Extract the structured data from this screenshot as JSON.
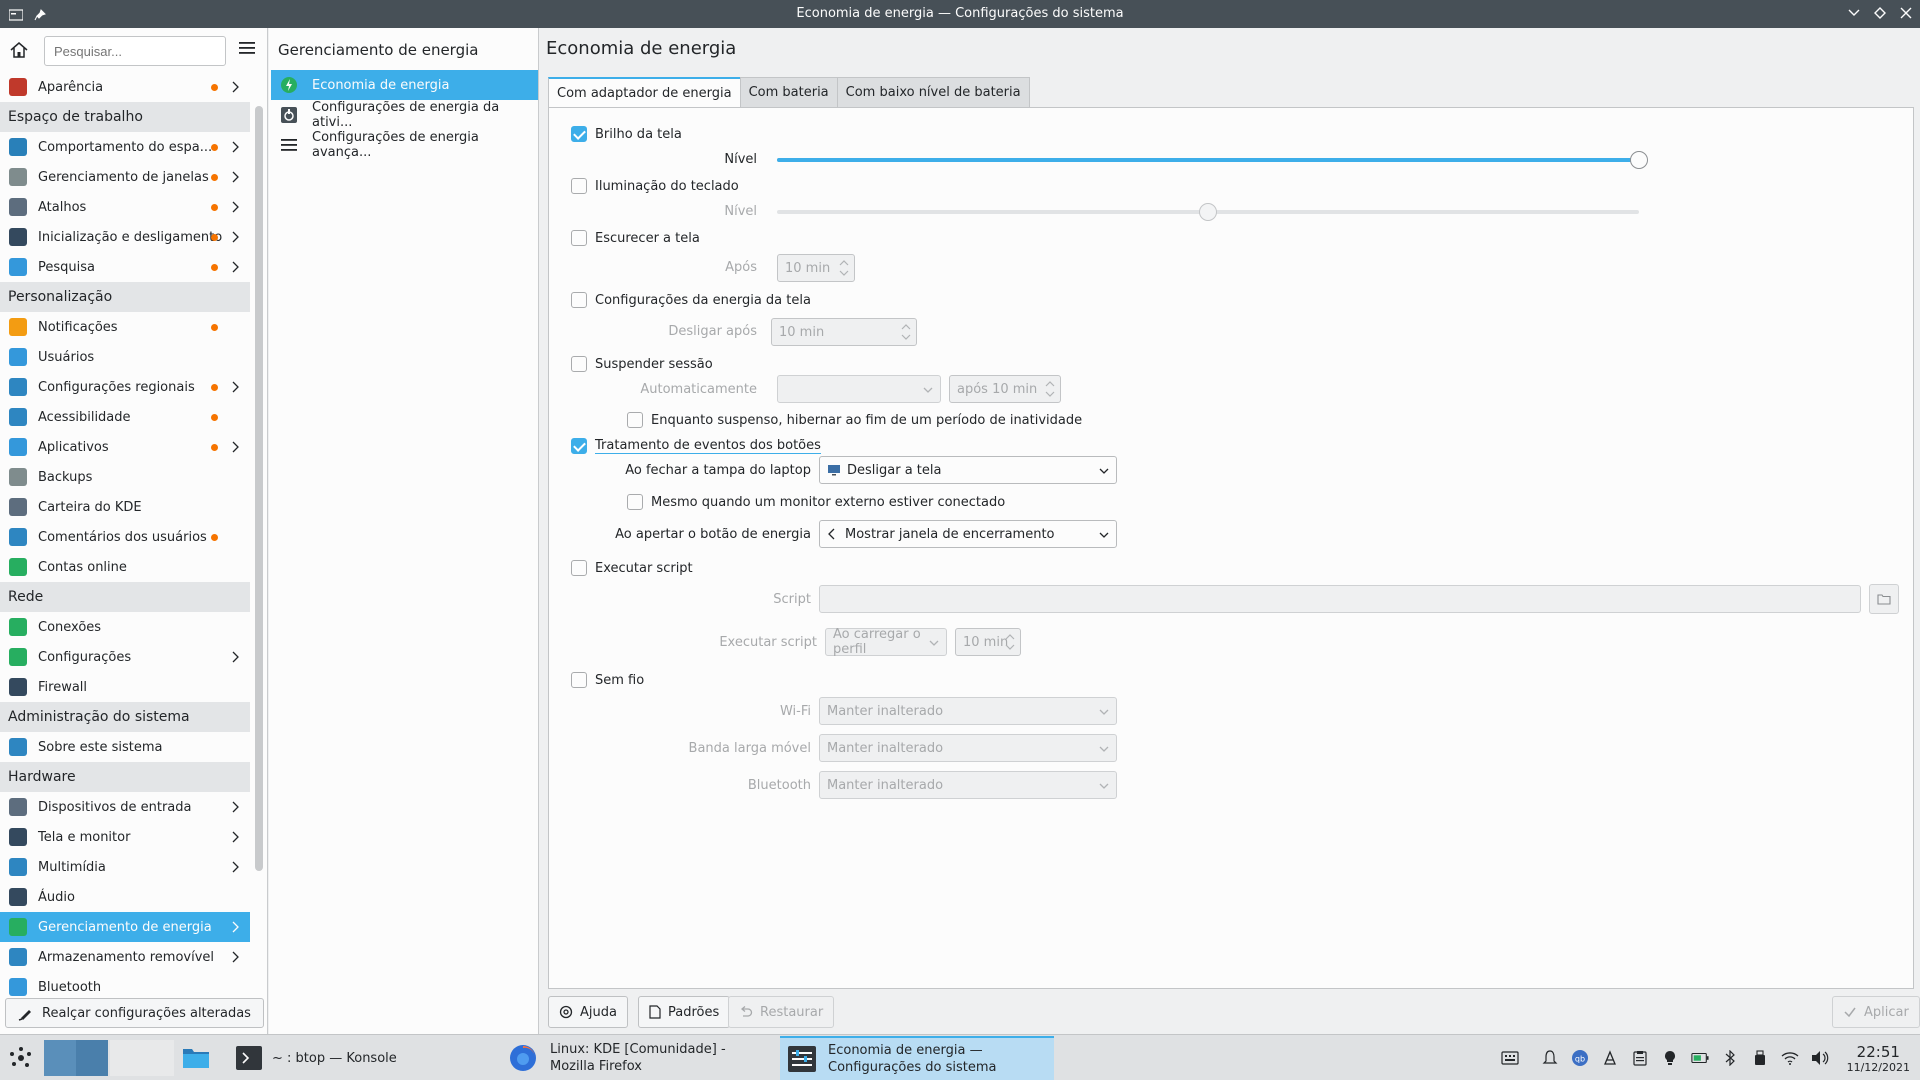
{
  "window": {
    "title": "Economia de energia — Configurações do sistema"
  },
  "sidebar": {
    "search_placeholder": "Pesquisar...",
    "items": [
      {
        "label": "Aparência",
        "type": "item",
        "dot": true,
        "chevron": true,
        "icon": "appearance-icon",
        "color": "#c0392b"
      },
      {
        "label": "Espaço de trabalho",
        "type": "header"
      },
      {
        "label": "Comportamento do espa...",
        "type": "item",
        "dot": true,
        "chevron": true,
        "icon": "workspace-behavior-icon",
        "color": "#2980b9"
      },
      {
        "label": "Gerenciamento de janelas",
        "type": "item",
        "dot": true,
        "chevron": true,
        "icon": "window-management-icon",
        "color": "#7f8c8d"
      },
      {
        "label": "Atalhos",
        "type": "item",
        "dot": true,
        "chevron": true,
        "icon": "keyboard-icon",
        "color": "#5d6d7e"
      },
      {
        "label": "Inicialização e desligamento",
        "type": "item",
        "dot": true,
        "chevron": true,
        "icon": "startup-shutdown-icon",
        "color": "#34495e"
      },
      {
        "label": "Pesquisa",
        "type": "item",
        "dot": true,
        "chevron": true,
        "icon": "search-icon",
        "color": "#3498db"
      },
      {
        "label": "Personalização",
        "type": "header"
      },
      {
        "label": "Notificações",
        "type": "item",
        "dot": true,
        "chevron": false,
        "icon": "bell-icon",
        "color": "#f39c12"
      },
      {
        "label": "Usuários",
        "type": "item",
        "dot": false,
        "chevron": false,
        "icon": "users-icon",
        "color": "#3498db"
      },
      {
        "label": "Configurações regionais",
        "type": "item",
        "dot": true,
        "chevron": true,
        "icon": "regional-icon",
        "color": "#2e86c1"
      },
      {
        "label": "Acessibilidade",
        "type": "item",
        "dot": true,
        "chevron": false,
        "icon": "accessibility-icon",
        "color": "#2e86c1"
      },
      {
        "label": "Aplicativos",
        "type": "item",
        "dot": true,
        "chevron": true,
        "icon": "applications-icon",
        "color": "#3498db"
      },
      {
        "label": "Backups",
        "type": "item",
        "dot": false,
        "chevron": false,
        "icon": "backup-icon",
        "color": "#7f8c8d"
      },
      {
        "label": "Carteira do KDE",
        "type": "item",
        "dot": false,
        "chevron": false,
        "icon": "wallet-icon",
        "color": "#5d6d7e"
      },
      {
        "label": "Comentários dos usuários",
        "type": "item",
        "dot": true,
        "chevron": false,
        "icon": "feedback-icon",
        "color": "#2e86c1"
      },
      {
        "label": "Contas online",
        "type": "item",
        "dot": false,
        "chevron": false,
        "icon": "online-accounts-icon",
        "color": "#27ae60"
      },
      {
        "label": "Rede",
        "type": "header"
      },
      {
        "label": "Conexões",
        "type": "item",
        "dot": false,
        "chevron": false,
        "icon": "connections-icon",
        "color": "#27ae60"
      },
      {
        "label": "Configurações",
        "type": "item",
        "dot": false,
        "chevron": true,
        "icon": "network-settings-icon",
        "color": "#27ae60"
      },
      {
        "label": "Firewall",
        "type": "item",
        "dot": false,
        "chevron": false,
        "icon": "firewall-icon",
        "color": "#34495e"
      },
      {
        "label": "Administração do sistema",
        "type": "header"
      },
      {
        "label": "Sobre este sistema",
        "type": "item",
        "dot": false,
        "chevron": false,
        "icon": "info-icon",
        "color": "#2e86c1"
      },
      {
        "label": "Hardware",
        "type": "header"
      },
      {
        "label": "Dispositivos de entrada",
        "type": "item",
        "dot": false,
        "chevron": true,
        "icon": "input-devices-icon",
        "color": "#5d6d7e"
      },
      {
        "label": "Tela e monitor",
        "type": "item",
        "dot": false,
        "chevron": true,
        "icon": "monitor-icon",
        "color": "#34495e"
      },
      {
        "label": "Multimídia",
        "type": "item",
        "dot": false,
        "chevron": true,
        "icon": "multimedia-icon",
        "color": "#2e86c1"
      },
      {
        "label": "Áudio",
        "type": "item",
        "dot": false,
        "chevron": false,
        "icon": "audio-icon",
        "color": "#34495e"
      },
      {
        "label": "Gerenciamento de energia",
        "type": "item",
        "dot": false,
        "chevron": true,
        "icon": "power-management-icon",
        "color": "#27ae60",
        "selected": true
      },
      {
        "label": "Armazenamento removível",
        "type": "item",
        "dot": false,
        "chevron": true,
        "icon": "removable-storage-icon",
        "color": "#2e86c1"
      },
      {
        "label": "Bluetooth",
        "type": "item",
        "dot": false,
        "chevron": false,
        "icon": "bluetooth-icon",
        "color": "#3498db"
      }
    ],
    "highlight_button": "Realçar configurações alteradas"
  },
  "midpanel": {
    "title": "Gerenciamento de energia",
    "items": [
      {
        "label": "Economia de energia",
        "selected": true,
        "icon": "energy-saving-icon"
      },
      {
        "label": "Configurações de energia da ativi...",
        "selected": false,
        "icon": "activity-power-icon"
      },
      {
        "label": "Configurações de energia avança...",
        "selected": false,
        "icon": "advanced-power-icon"
      }
    ]
  },
  "main": {
    "title": "Economia de energia",
    "tabs": [
      "Com adaptador de energia",
      "Com bateria",
      "Com baixo nível de bateria"
    ],
    "brightness": {
      "label": "Brilho da tela",
      "checked": true,
      "level_label": "Nível",
      "level": 1.0
    },
    "keyboard": {
      "label": "Iluminação do teclado",
      "checked": false,
      "level_label": "Nível",
      "level": 0.5
    },
    "dim": {
      "label": "Escurecer a tela",
      "checked": false,
      "after_label": "Após",
      "after_value": "10 min"
    },
    "screen_energy": {
      "label": "Configurações da energia da tela",
      "checked": false,
      "off_label": "Desligar após",
      "off_value": "10 min"
    },
    "suspend": {
      "label": "Suspender sessão",
      "checked": false,
      "auto_label": "Automaticamente",
      "auto_value": "",
      "after_value": "após 10 min",
      "hibernate_label": "Enquanto suspenso, hibernar ao fim de um período de inatividade",
      "hibernate_checked": false
    },
    "buttons": {
      "label": "Tratamento de eventos dos botões",
      "checked": true,
      "lid_label": "Ao fechar a tampa do laptop",
      "lid_value": "Desligar a tela",
      "external_label": "Mesmo quando um monitor externo estiver conectado",
      "external_checked": false,
      "power_label": "Ao apertar o botão de energia",
      "power_value": "Mostrar janela de encerramento"
    },
    "script": {
      "label": "Executar script",
      "checked": false,
      "script_label": "Script",
      "script_value": "",
      "run_label": "Executar script",
      "run_value": "Ao carregar o perfil",
      "run_time": "10 min"
    },
    "wireless": {
      "label": "Sem fio",
      "checked": false,
      "wifi_label": "Wi-Fi",
      "wifi_value": "Manter inalterado",
      "mobile_label": "Banda larga móvel",
      "mobile_value": "Manter inalterado",
      "bt_label": "Bluetooth",
      "bt_value": "Manter inalterado"
    },
    "footer": {
      "help": "Ajuda",
      "defaults": "Padrões",
      "reset": "Restaurar",
      "apply": "Aplicar"
    }
  },
  "taskbar": {
    "tasks": [
      {
        "label": "~ : btop — Konsole",
        "icon": "konsole-icon"
      },
      {
        "label": "Linux: KDE [Comunidade] - Mozilla Firefox",
        "icon": "firefox-icon"
      },
      {
        "label": "Economia de energia — Configurações do sistema",
        "icon": "system-settings-icon",
        "active": true
      }
    ],
    "time": "22:51",
    "date": "11/12/2021"
  },
  "colors": {
    "accent": "#3daee9",
    "dot": "#f67400",
    "titlebar": "#475057"
  }
}
